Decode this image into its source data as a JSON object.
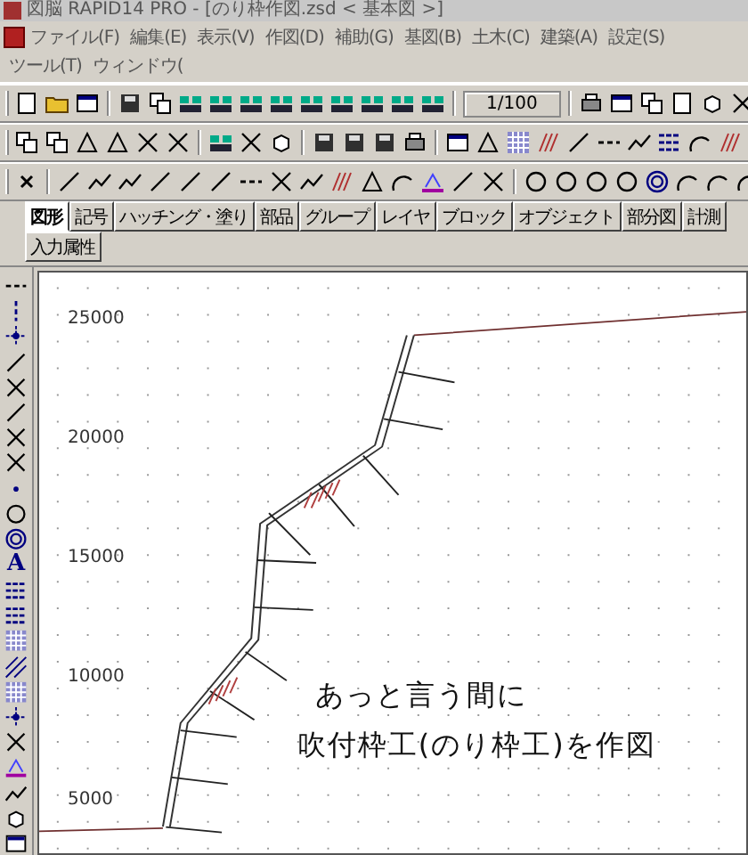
{
  "window": {
    "title": "図脳 RAPID14 PRO - [のり枠作図.zsd < 基本図 >]"
  },
  "menu_bar": [
    "ファイル(F)",
    "編集(E)",
    "表示(V)",
    "作図(D)",
    "補助(G)",
    "基図(B)",
    "土木(C)",
    "建築(A)",
    "設定(S)",
    "ツール(T)",
    "ウィンドウ("
  ],
  "toolbar": {
    "scale": "1/100"
  },
  "tabs": [
    {
      "label": "図形",
      "selected": true
    },
    {
      "label": "記号",
      "selected": false
    },
    {
      "label": "ハッチング・塗り",
      "selected": false
    },
    {
      "label": "部品",
      "selected": false
    },
    {
      "label": "グループ",
      "selected": false
    },
    {
      "label": "レイヤ",
      "selected": false
    },
    {
      "label": "ブロック",
      "selected": false
    },
    {
      "label": "オブジェクト",
      "selected": false
    },
    {
      "label": "部分図",
      "selected": false
    },
    {
      "label": "計測",
      "selected": false
    },
    {
      "label": "入力属性",
      "selected": false
    }
  ],
  "left_toolbar": {
    "text_tool_glyph": "A"
  },
  "canvas": {
    "y_axis_labels": [
      "25000",
      "20000",
      "15000",
      "10000",
      "5000"
    ],
    "caption": [
      "あっと言う間に",
      "吹付枠工(のり枠工)を作図"
    ]
  }
}
